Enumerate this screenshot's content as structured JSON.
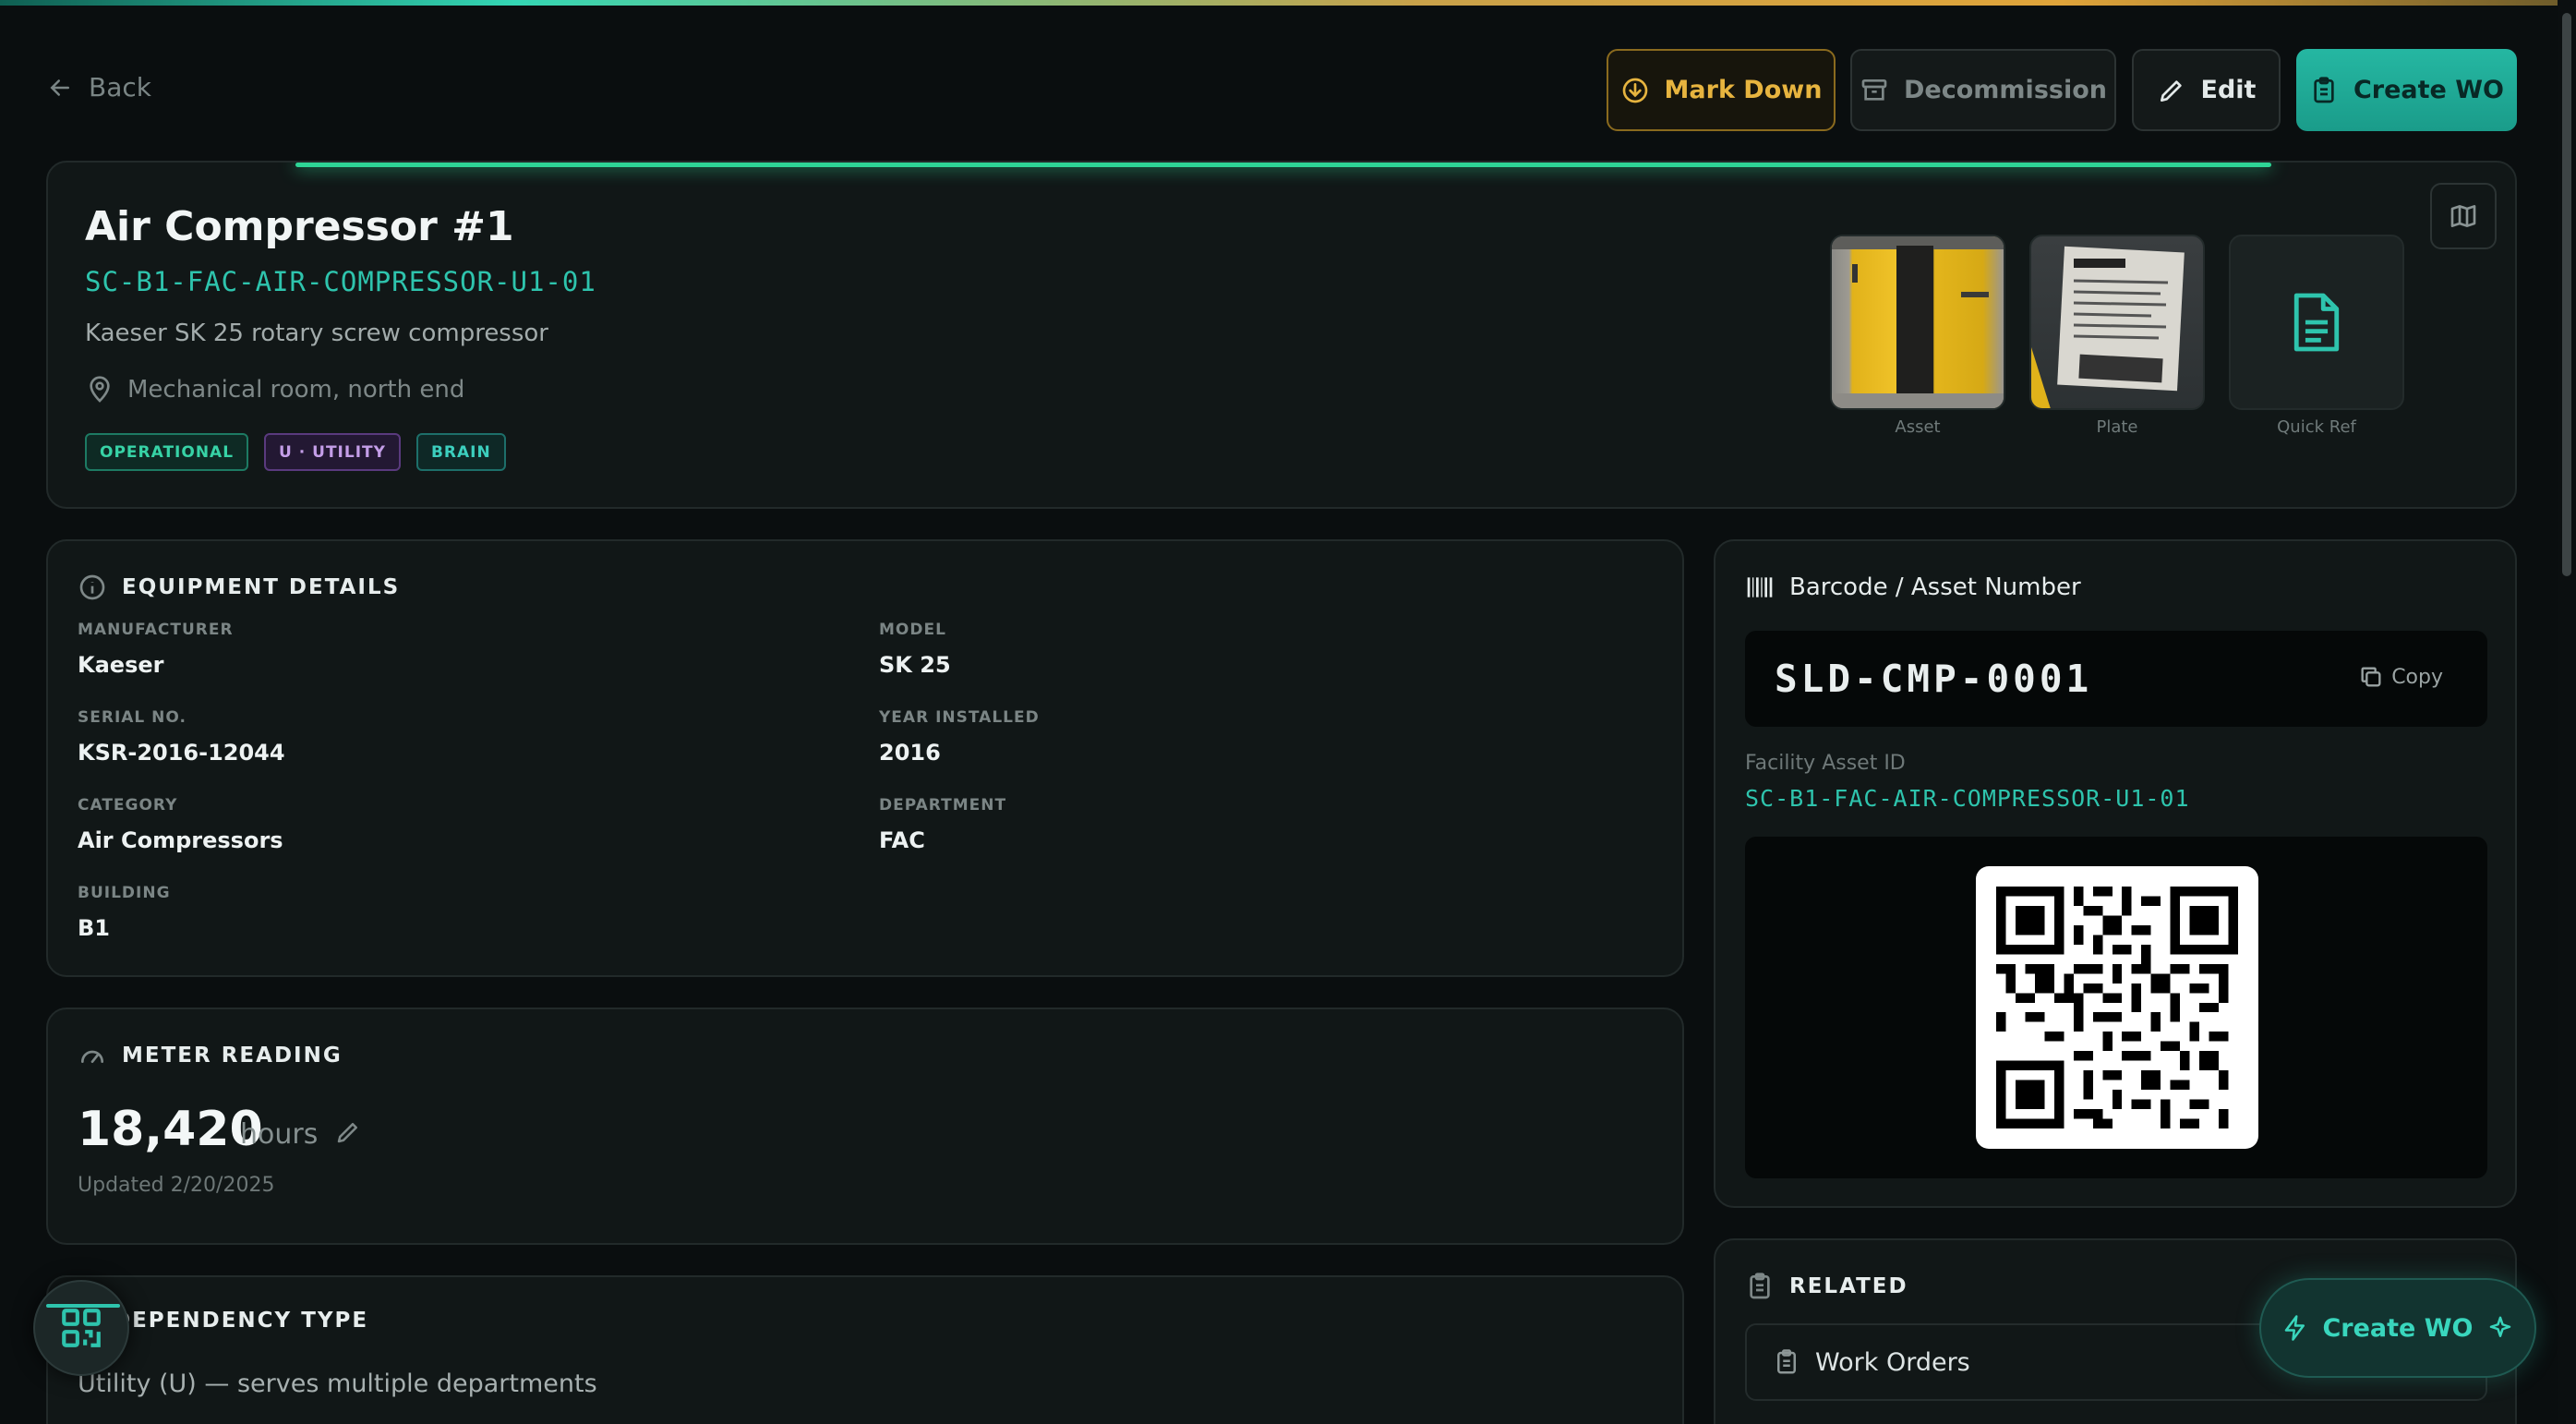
{
  "header": {
    "back_label": "Back",
    "actions": {
      "mark_down": "Mark Down",
      "decommission": "Decommission",
      "edit": "Edit",
      "create_wo": "Create WO"
    }
  },
  "asset": {
    "name": "Air Compressor #1",
    "facility_id": "SC-B1-FAC-AIR-COMPRESSOR-U1-01",
    "description": "Kaeser SK 25 rotary screw compressor",
    "location": "Mechanical room, north end",
    "tags": [
      "OPERATIONAL",
      "U · UTILITY",
      "BRAIN"
    ],
    "thumbnails": [
      {
        "caption": "Asset",
        "icon": "photo"
      },
      {
        "caption": "Plate",
        "icon": "photo"
      },
      {
        "caption": "Quick Ref",
        "icon": "document-icon"
      }
    ]
  },
  "equipment_details": {
    "title": "EQUIPMENT DETAILS",
    "fields": [
      {
        "label": "MANUFACTURER",
        "value": "Kaeser"
      },
      {
        "label": "MODEL",
        "value": "SK 25"
      },
      {
        "label": "SERIAL NO.",
        "value": "KSR-2016-12044"
      },
      {
        "label": "YEAR INSTALLED",
        "value": "2016"
      },
      {
        "label": "CATEGORY",
        "value": "Air Compressors"
      },
      {
        "label": "DEPARTMENT",
        "value": "FAC"
      },
      {
        "label": "BUILDING",
        "value": "B1"
      }
    ]
  },
  "meter_reading": {
    "title": "METER READING",
    "value": "18,420",
    "unit": "hours",
    "updated": "Updated 2/20/2025"
  },
  "dependency": {
    "title": "DEPENDENCY TYPE",
    "text": "Utility (U) — serves multiple departments"
  },
  "barcode": {
    "title": "Barcode / Asset Number",
    "code": "SLD-CMP-0001",
    "copy_label": "Copy",
    "facility_label": "Facility Asset ID",
    "facility_value": "SC-B1-FAC-AIR-COMPRESSOR-U1-01"
  },
  "related": {
    "title": "RELATED",
    "items": [
      "Work Orders"
    ]
  },
  "fab": {
    "create_wo": "Create WO"
  },
  "colors": {
    "accent": "#2ec4ad",
    "operational": "#37d3a6",
    "warning": "#e7b43f",
    "utility": "#c49ee8"
  }
}
